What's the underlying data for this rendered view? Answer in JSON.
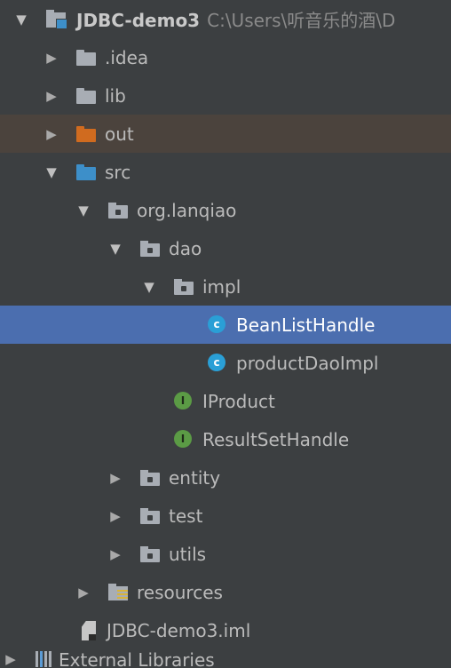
{
  "tree": {
    "root": {
      "name": "JDBC-demo3",
      "path": "C:\\Users\\听音乐的酒\\D"
    },
    "idea": ".idea",
    "lib": "lib",
    "out": "out",
    "src": "src",
    "pkg": "org.lanqiao",
    "dao": "dao",
    "impl": "impl",
    "bean_list_handle": "BeanListHandle",
    "product_dao_impl": "productDaoImpl",
    "iproduct": "IProduct",
    "result_set_handle": "ResultSetHandle",
    "entity": "entity",
    "test": "test",
    "utils": "utils",
    "resources": "resources",
    "iml": "JDBC-demo3.iml",
    "external_libraries": "External Libraries",
    "class_badge": "c",
    "interface_badge": "I"
  },
  "selected_item": "BeanListHandle",
  "colors": {
    "background": "#3c3f41",
    "selection": "#4b6eaf",
    "out_highlight": "#4b433d",
    "class_icon": "#2a9fd6",
    "interface_icon": "#5b9b45"
  }
}
